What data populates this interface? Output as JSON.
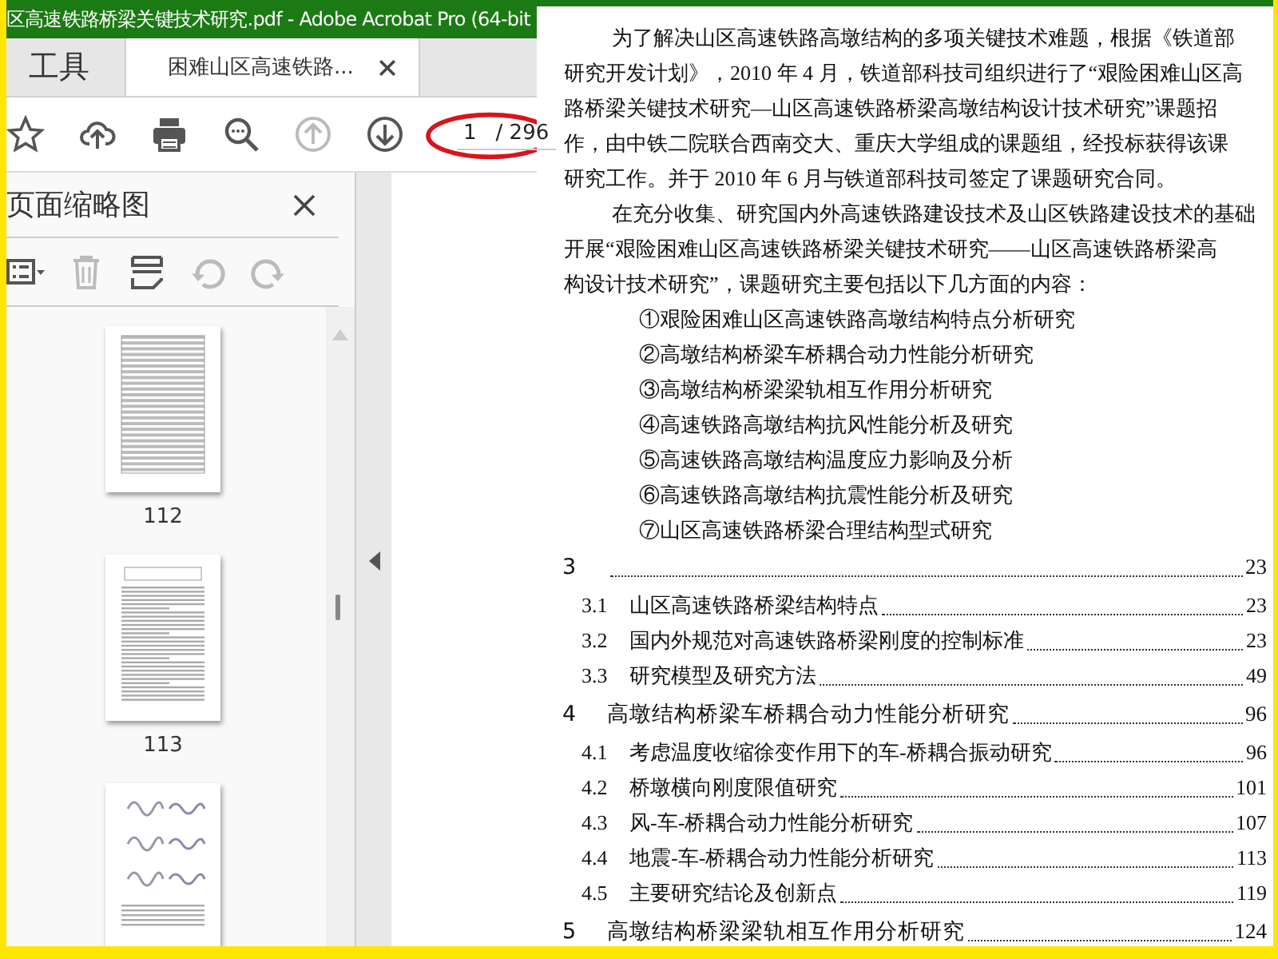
{
  "window": {
    "title": "区高速铁路桥梁关键技术研究.pdf - Adobe Acrobat Pro (64-bit"
  },
  "tabs": [
    {
      "label": "工具",
      "selected": false,
      "closable": false
    },
    {
      "label": "困难山区高速铁路...",
      "selected": true,
      "closable": true
    }
  ],
  "toolbar": {
    "buttons": [
      {
        "disabled": false
      },
      {
        "disabled": false
      },
      {
        "disabled": false
      },
      {
        "disabled": false
      },
      {
        "disabled": true
      },
      {
        "disabled": false
      }
    ],
    "page_field": {
      "value": "1",
      "total": "/ 296",
      "highlighted": true
    }
  },
  "sidebar": {
    "title": "页面缩略图",
    "tools": [
      {
        "disabled": false
      },
      {
        "disabled": true
      },
      {
        "disabled": false
      },
      {
        "disabled": true
      },
      {
        "disabled": true
      }
    ],
    "thumbnails": [
      {
        "kind": "table",
        "label": "112"
      },
      {
        "kind": "text",
        "label": "113"
      },
      {
        "kind": "figure"
      }
    ]
  },
  "excerpt": {
    "paragraphs": [
      {
        "lines": [
          "为了解决山区高速铁路高墩结构的多项关键技术难题，根据《铁道部",
          "研究开发计划》，2010 年 4 月，铁道部科技司组织进行了“艰险困难山区高",
          "路桥梁关键技术研究—山区高速铁路桥梁高墩结构设计技术研究”课题招",
          "作，由中铁二院联合西南交大、重庆大学组成的课题组，经投标获得该课",
          "研究工作。并于 2010 年 6 月与铁道部科技司签定了课题研究合同。"
        ]
      },
      {
        "lines": [
          "在充分收集、研究国内外高速铁路建设技术及山区铁路建设技术的基础",
          "开展“艰险困难山区高速铁路桥梁关键技术研究——山区高速铁路桥梁高",
          "构设计技术研究”，课题研究主要包括以下几方面的内容："
        ]
      }
    ],
    "list": [
      "①艰险困难山区高速铁路高墩结构特点分析研究",
      "②高墩结构桥梁车桥耦合动力性能分析研究",
      "③高墩结构桥梁梁轨相互作用分析研究",
      "④高速铁路高墩结构抗风性能分析及研究",
      "⑤高速铁路高墩结构温度应力影响及分析",
      "⑥高速铁路高墩结构抗震性能分析及研究",
      "⑦山区高速铁路桥梁合理结构型式研究"
    ]
  },
  "toc": [
    {
      "number": "3",
      "page": "23",
      "children": [
        {
          "number": "3.1",
          "title": "山区高速铁路桥梁结构特点",
          "page": "23"
        },
        {
          "number": "3.2",
          "title": "国内外规范对高速铁路桥梁刚度的控制标准",
          "page": "23"
        },
        {
          "number": "3.3",
          "title": "研究模型及研究方法",
          "page": "49"
        }
      ]
    },
    {
      "number": "4",
      "title": "高墩结构桥梁车桥耦合动力性能分析研究",
      "page": "96",
      "children": [
        {
          "number": "4.1",
          "title": "考虑温度收缩徐变作用下的车-桥耦合振动研究",
          "page": "96"
        },
        {
          "number": "4.2",
          "title": "桥墩横向刚度限值研究",
          "page": "101"
        },
        {
          "number": "4.3",
          "title": "风-车-桥耦合动力性能分析研究",
          "page": "107"
        },
        {
          "number": "4.4",
          "title": "地震-车-桥耦合动力性能分析研究",
          "page": "113"
        },
        {
          "number": "4.5",
          "title": "主要研究结论及创新点",
          "page": "119"
        }
      ]
    },
    {
      "number": "5",
      "title": "高墩结构桥梁梁轨相互作用分析研究",
      "page": "124"
    }
  ]
}
